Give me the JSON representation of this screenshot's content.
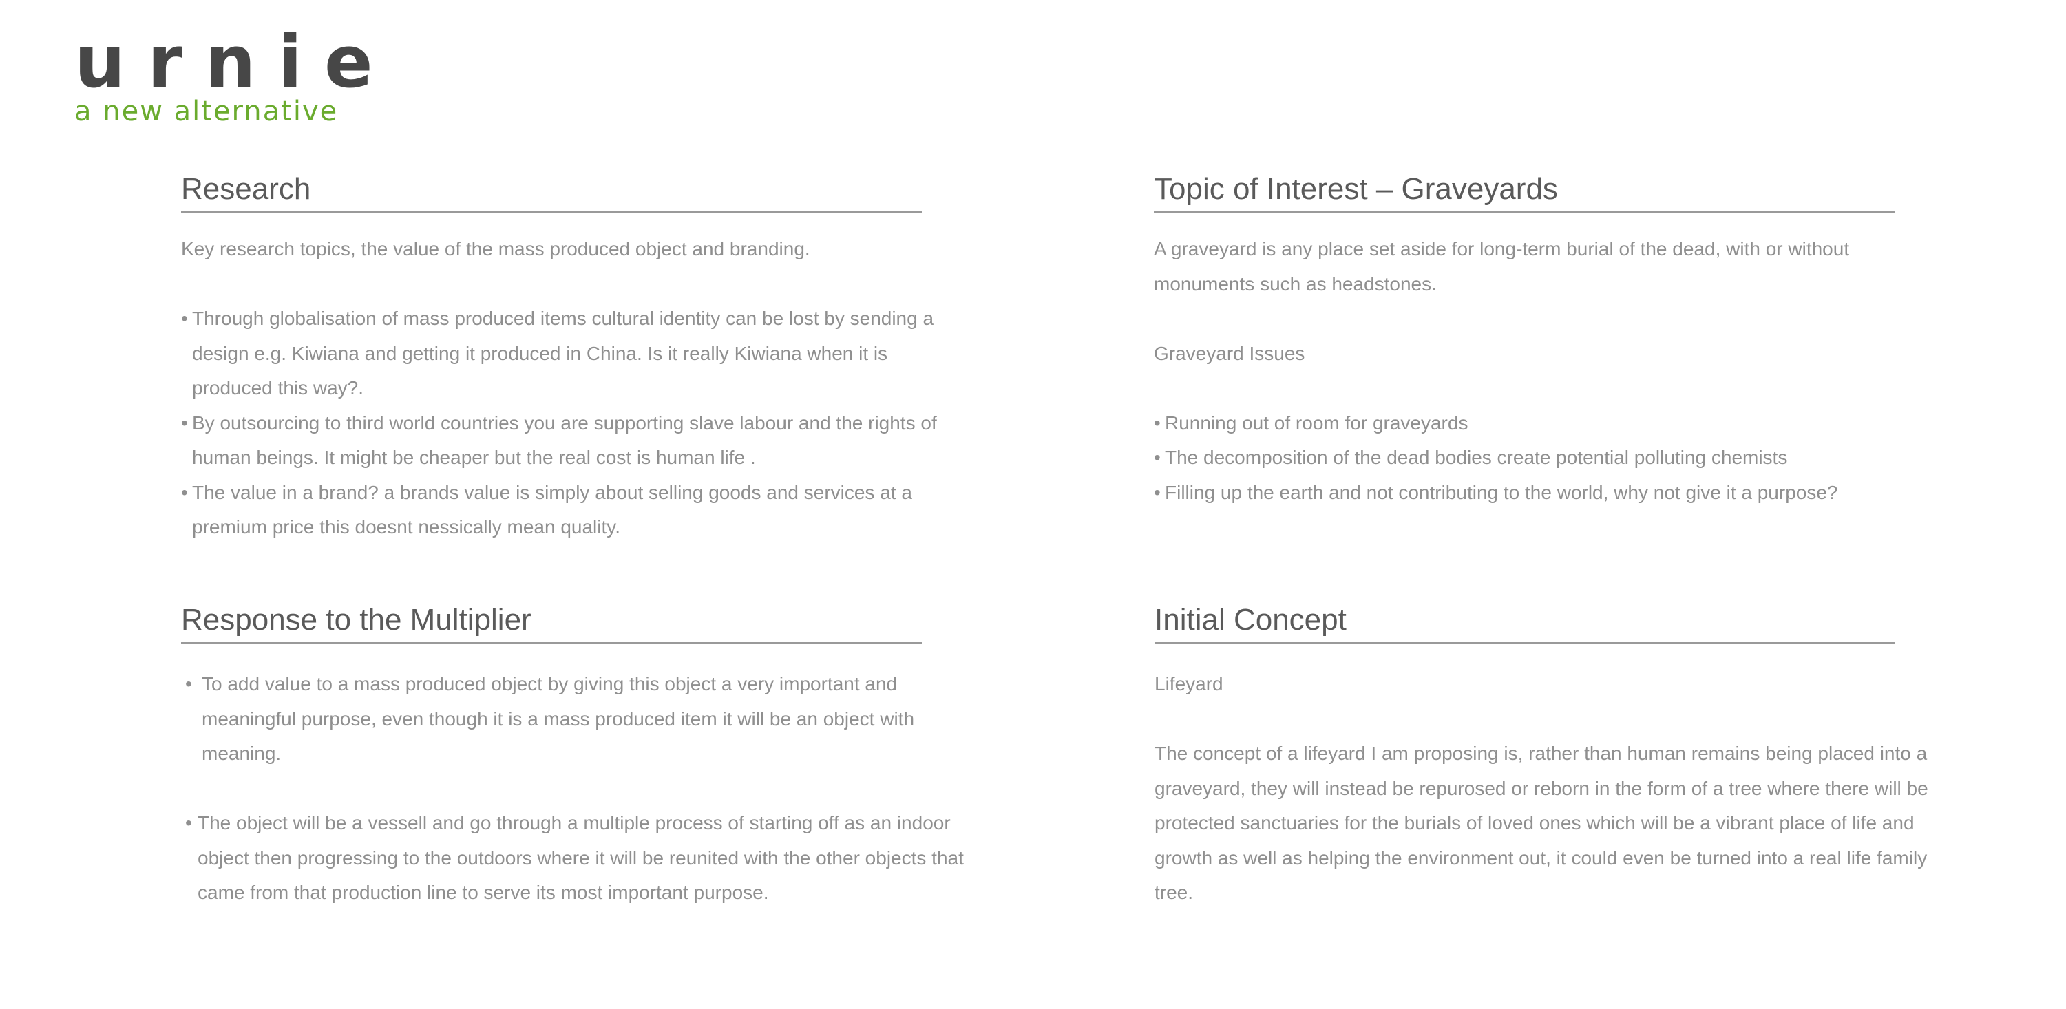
{
  "logo": {
    "word": "urnie",
    "tagline": "a new alternative"
  },
  "research": {
    "title": "Research",
    "intro": "Key research topics, the value of the mass produced object and branding.",
    "bullets": [
      "Through globalisation of mass produced items cultural identity can be lost by sending a design e.g. Kiwiana and getting it produced in China. Is it really Kiwiana when it is produced this way?.",
      "By outsourcing to third world countries you are supporting slave labour and the rights of human beings. It might be cheaper but the real cost is human life .",
      "The value in a brand? a brands value is simply about selling goods and services at a premium price this doesnt nessically mean quality."
    ]
  },
  "topic": {
    "title": "Topic of Interest – Graveyards",
    "intro": "A graveyard is any place set aside for long-term burial of the dead, with or without monuments such as headstones.",
    "subheading": "Graveyard Issues",
    "bullets": [
      "Running out of room for graveyards",
      "The decomposition of the dead bodies create potential polluting chemists",
      "Filling up the earth and not contributing to the world, why not give it a purpose?"
    ]
  },
  "response": {
    "title": "Response to the Multiplier",
    "bullets": [
      "To add value to a mass produced object by giving this object a very important and meaningful purpose, even though it is a mass produced item it will be an object with meaning.",
      "The object will be a vessell and go through a multiple process of starting off as an indoor object then progressing to the outdoors where it will be reunited with the other objects that came from that production line to serve its most important purpose."
    ]
  },
  "concept": {
    "title": "Initial Concept",
    "subheading": "Lifeyard",
    "paragraph": "The concept of a lifeyard I am proposing is, rather than human remains being placed into a graveyard, they will instead be repurosed or reborn in the form of a tree where there will be protected sanctuaries for the burials of loved ones which will be a vibrant place of life and growth as well as helping the environment out, it could even be turned into a real life family tree."
  },
  "colors": {
    "logo": "#474747",
    "tagline": "#6aab2e",
    "heading": "#5a5a5a",
    "body": "#8f8f8f",
    "rule": "#9a9a9a"
  }
}
